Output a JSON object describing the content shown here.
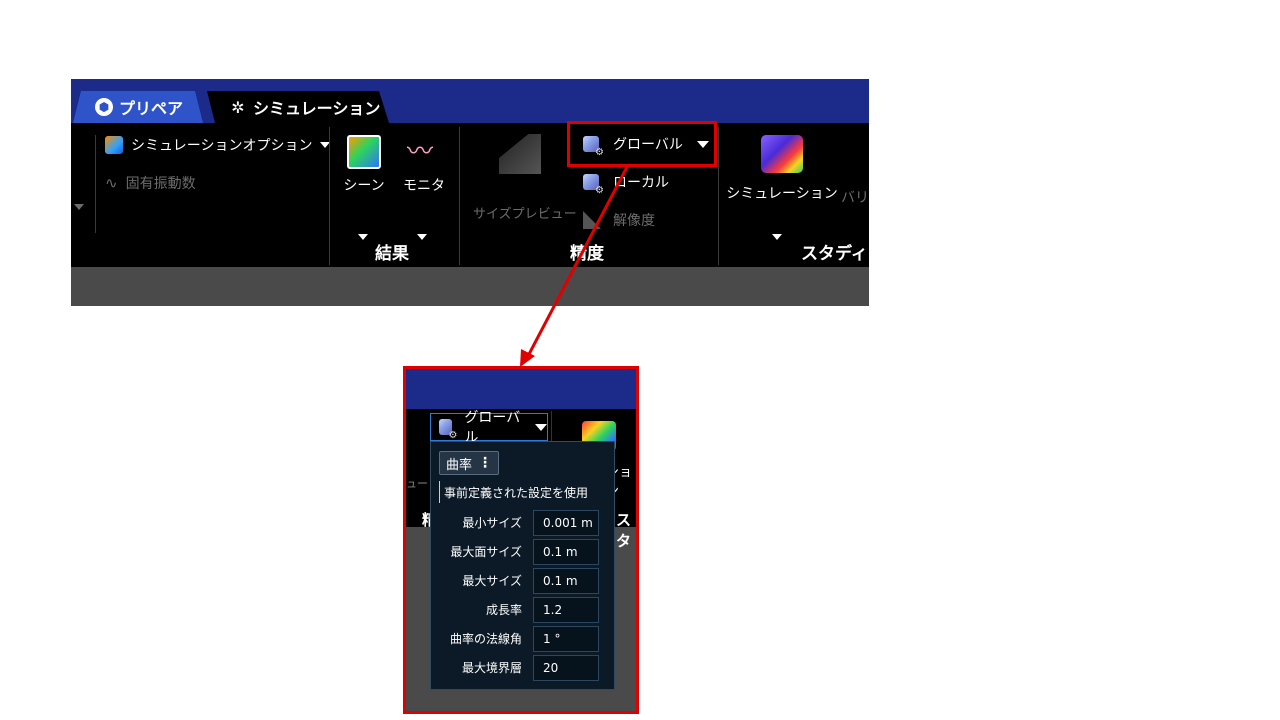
{
  "tabs": {
    "prep": "プリペア",
    "simulation": "シミュレーション"
  },
  "ribbon": {
    "sim_options": "シミュレーションオプション",
    "natural_freq": "固有振動数",
    "scene": "シーン",
    "monitor": "モニタ",
    "results_group": "結果",
    "size_preview": "サイズプレビュー",
    "global": "グローバル",
    "local": "ローカル",
    "resolution": "解像度",
    "precision_group": "精度",
    "simulation_btn": "シミュレーション",
    "variation_partial": "バリエ",
    "study_group": "スタディ"
  },
  "zoom": {
    "global": "グローバル",
    "partial_sim": "ション",
    "partial_size": "ュー",
    "partial_study": "スタ",
    "partial_precision": "精"
  },
  "popup": {
    "mode_chip": "曲率",
    "preset_text": "事前定義された設定を使用",
    "fields": [
      {
        "label": "最小サイズ",
        "value": "0.001 m"
      },
      {
        "label": "最大面サイズ",
        "value": "0.1 m"
      },
      {
        "label": "最大サイズ",
        "value": "0.1 m"
      },
      {
        "label": "成長率",
        "value": "1.2"
      },
      {
        "label": "曲率の法線角",
        "value": "1 °"
      },
      {
        "label": "最大境界層",
        "value": "20"
      }
    ]
  },
  "colors": {
    "tab_bar": "#1c2a8a",
    "highlight": "#e10000",
    "popup_bg": "#0b1a26"
  }
}
